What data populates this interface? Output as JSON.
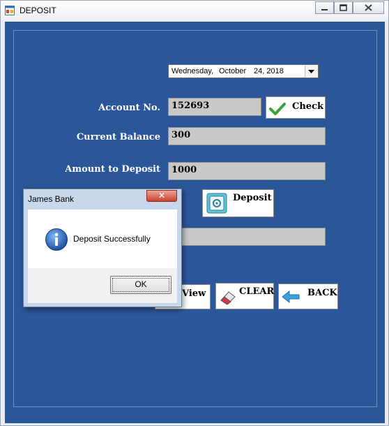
{
  "window": {
    "title": "DEPOSIT",
    "icon": "app-form-icon",
    "controls": {
      "minimize": "minimize-icon",
      "maximize": "maximize-icon",
      "close": "close-icon"
    }
  },
  "form": {
    "date": {
      "day": "Wednesday,",
      "month": "October",
      "date_year": "24, 2018"
    },
    "account_label": "Account No.",
    "account_value": "152693",
    "check_button": "Check",
    "balance_label": "Current Balance",
    "balance_value": "300",
    "amount_label": "Amount to Deposit",
    "amount_value": "1000",
    "deposit_button": "Deposit",
    "new_balance_value": "",
    "view_button": "View",
    "clear_button": "CLEAR",
    "back_button": "BACK"
  },
  "dialog": {
    "title": "James Bank",
    "message": "Deposit Successfully",
    "ok_button": "OK",
    "close_glyph": "✕",
    "icon": "info-icon"
  },
  "colors": {
    "form_background": "#2b579a",
    "textbox_background": "#c8c8c8"
  }
}
